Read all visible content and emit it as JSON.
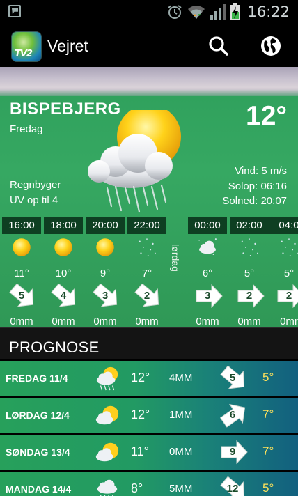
{
  "status_bar": {
    "time": "16:22"
  },
  "app_bar": {
    "logo_text": "TV2",
    "title": "Vejret",
    "search_icon": "search-icon",
    "globe_icon": "globe-icon"
  },
  "current": {
    "city": "BISPEBJERG",
    "day": "Fredag",
    "temperature": "12°",
    "condition": "Regnbyger",
    "uv": "UV op til 4",
    "wind": "Vind: 5 m/s",
    "sunrise": "Solop: 06:16",
    "sunset": "Solned: 20:07",
    "icon": "sun-cloud-rain-icon"
  },
  "hourly": {
    "day_divider": "lørdag",
    "columns": [
      {
        "time": "16:00",
        "icon": "sun-icon",
        "temp": "11°",
        "wind": "5",
        "rain": "0mm"
      },
      {
        "time": "18:00",
        "icon": "sun-icon",
        "temp": "10°",
        "wind": "4",
        "rain": "0mm"
      },
      {
        "time": "20:00",
        "icon": "sun-icon",
        "temp": "9°",
        "wind": "3",
        "rain": "0mm"
      },
      {
        "time": "22:00",
        "icon": "clear-night-icon",
        "temp": "7°",
        "wind": "2",
        "rain": "0mm"
      },
      {
        "time": "00:00",
        "icon": "cloudy-night-icon",
        "temp": "6°",
        "wind": "3",
        "rain": "0mm"
      },
      {
        "time": "02:00",
        "icon": "clear-night-icon",
        "temp": "5°",
        "wind": "2",
        "rain": "0mm"
      },
      {
        "time": "04:0",
        "icon": "clear-night-icon",
        "temp": "5°",
        "wind": "2",
        "rain": "0mr"
      }
    ]
  },
  "forecast": {
    "header": "PROGNOSE",
    "rows": [
      {
        "day": "FREDAG 11/4",
        "icon": "sun-cloud-rain-icon",
        "temp": "12°",
        "rain": "4MM",
        "wind": "5",
        "low": "5°"
      },
      {
        "day": "LØRDAG 12/4",
        "icon": "sun-cloud-icon",
        "temp": "12°",
        "rain": "1MM",
        "wind": "6",
        "low": "7°"
      },
      {
        "day": "SØNDAG 13/4",
        "icon": "sun-cloud-icon",
        "temp": "11°",
        "rain": "0MM",
        "wind": "9",
        "low": "7°"
      },
      {
        "day": "MANDAG 14/4",
        "icon": "cloud-rain-icon",
        "temp": "8°",
        "rain": "5MM",
        "wind": "12",
        "low": "5°"
      }
    ]
  }
}
